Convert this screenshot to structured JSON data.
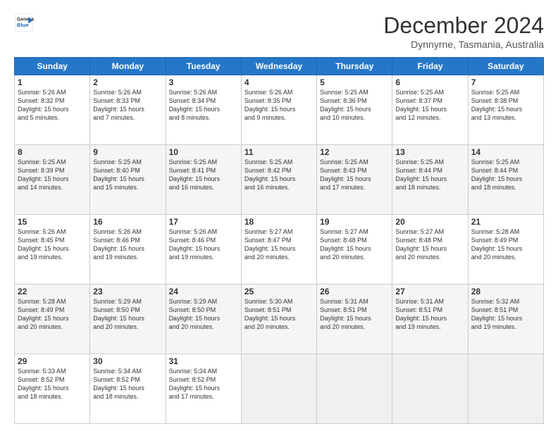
{
  "header": {
    "logo_line1": "General",
    "logo_line2": "Blue",
    "month": "December 2024",
    "location": "Dynnyrne, Tasmania, Australia"
  },
  "weekdays": [
    "Sunday",
    "Monday",
    "Tuesday",
    "Wednesday",
    "Thursday",
    "Friday",
    "Saturday"
  ],
  "weeks": [
    [
      {
        "day": "1",
        "info": "Sunrise: 5:26 AM\nSunset: 8:32 PM\nDaylight: 15 hours\nand 5 minutes."
      },
      {
        "day": "2",
        "info": "Sunrise: 5:26 AM\nSunset: 8:33 PM\nDaylight: 15 hours\nand 7 minutes."
      },
      {
        "day": "3",
        "info": "Sunrise: 5:26 AM\nSunset: 8:34 PM\nDaylight: 15 hours\nand 8 minutes."
      },
      {
        "day": "4",
        "info": "Sunrise: 5:26 AM\nSunset: 8:35 PM\nDaylight: 15 hours\nand 9 minutes."
      },
      {
        "day": "5",
        "info": "Sunrise: 5:25 AM\nSunset: 8:36 PM\nDaylight: 15 hours\nand 10 minutes."
      },
      {
        "day": "6",
        "info": "Sunrise: 5:25 AM\nSunset: 8:37 PM\nDaylight: 15 hours\nand 12 minutes."
      },
      {
        "day": "7",
        "info": "Sunrise: 5:25 AM\nSunset: 8:38 PM\nDaylight: 15 hours\nand 13 minutes."
      }
    ],
    [
      {
        "day": "8",
        "info": "Sunrise: 5:25 AM\nSunset: 8:39 PM\nDaylight: 15 hours\nand 14 minutes."
      },
      {
        "day": "9",
        "info": "Sunrise: 5:25 AM\nSunset: 8:40 PM\nDaylight: 15 hours\nand 15 minutes."
      },
      {
        "day": "10",
        "info": "Sunrise: 5:25 AM\nSunset: 8:41 PM\nDaylight: 15 hours\nand 16 minutes."
      },
      {
        "day": "11",
        "info": "Sunrise: 5:25 AM\nSunset: 8:42 PM\nDaylight: 15 hours\nand 16 minutes."
      },
      {
        "day": "12",
        "info": "Sunrise: 5:25 AM\nSunset: 8:43 PM\nDaylight: 15 hours\nand 17 minutes."
      },
      {
        "day": "13",
        "info": "Sunrise: 5:25 AM\nSunset: 8:44 PM\nDaylight: 15 hours\nand 18 minutes."
      },
      {
        "day": "14",
        "info": "Sunrise: 5:25 AM\nSunset: 8:44 PM\nDaylight: 15 hours\nand 18 minutes."
      }
    ],
    [
      {
        "day": "15",
        "info": "Sunrise: 5:26 AM\nSunset: 8:45 PM\nDaylight: 15 hours\nand 19 minutes."
      },
      {
        "day": "16",
        "info": "Sunrise: 5:26 AM\nSunset: 8:46 PM\nDaylight: 15 hours\nand 19 minutes."
      },
      {
        "day": "17",
        "info": "Sunrise: 5:26 AM\nSunset: 8:46 PM\nDaylight: 15 hours\nand 19 minutes."
      },
      {
        "day": "18",
        "info": "Sunrise: 5:27 AM\nSunset: 8:47 PM\nDaylight: 15 hours\nand 20 minutes."
      },
      {
        "day": "19",
        "info": "Sunrise: 5:27 AM\nSunset: 8:48 PM\nDaylight: 15 hours\nand 20 minutes."
      },
      {
        "day": "20",
        "info": "Sunrise: 5:27 AM\nSunset: 8:48 PM\nDaylight: 15 hours\nand 20 minutes."
      },
      {
        "day": "21",
        "info": "Sunrise: 5:28 AM\nSunset: 8:49 PM\nDaylight: 15 hours\nand 20 minutes."
      }
    ],
    [
      {
        "day": "22",
        "info": "Sunrise: 5:28 AM\nSunset: 8:49 PM\nDaylight: 15 hours\nand 20 minutes."
      },
      {
        "day": "23",
        "info": "Sunrise: 5:29 AM\nSunset: 8:50 PM\nDaylight: 15 hours\nand 20 minutes."
      },
      {
        "day": "24",
        "info": "Sunrise: 5:29 AM\nSunset: 8:50 PM\nDaylight: 15 hours\nand 20 minutes."
      },
      {
        "day": "25",
        "info": "Sunrise: 5:30 AM\nSunset: 8:51 PM\nDaylight: 15 hours\nand 20 minutes."
      },
      {
        "day": "26",
        "info": "Sunrise: 5:31 AM\nSunset: 8:51 PM\nDaylight: 15 hours\nand 20 minutes."
      },
      {
        "day": "27",
        "info": "Sunrise: 5:31 AM\nSunset: 8:51 PM\nDaylight: 15 hours\nand 19 minutes."
      },
      {
        "day": "28",
        "info": "Sunrise: 5:32 AM\nSunset: 8:51 PM\nDaylight: 15 hours\nand 19 minutes."
      }
    ],
    [
      {
        "day": "29",
        "info": "Sunrise: 5:33 AM\nSunset: 8:52 PM\nDaylight: 15 hours\nand 18 minutes."
      },
      {
        "day": "30",
        "info": "Sunrise: 5:34 AM\nSunset: 8:52 PM\nDaylight: 15 hours\nand 18 minutes."
      },
      {
        "day": "31",
        "info": "Sunrise: 5:34 AM\nSunset: 8:52 PM\nDaylight: 15 hours\nand 17 minutes."
      },
      null,
      null,
      null,
      null
    ]
  ]
}
